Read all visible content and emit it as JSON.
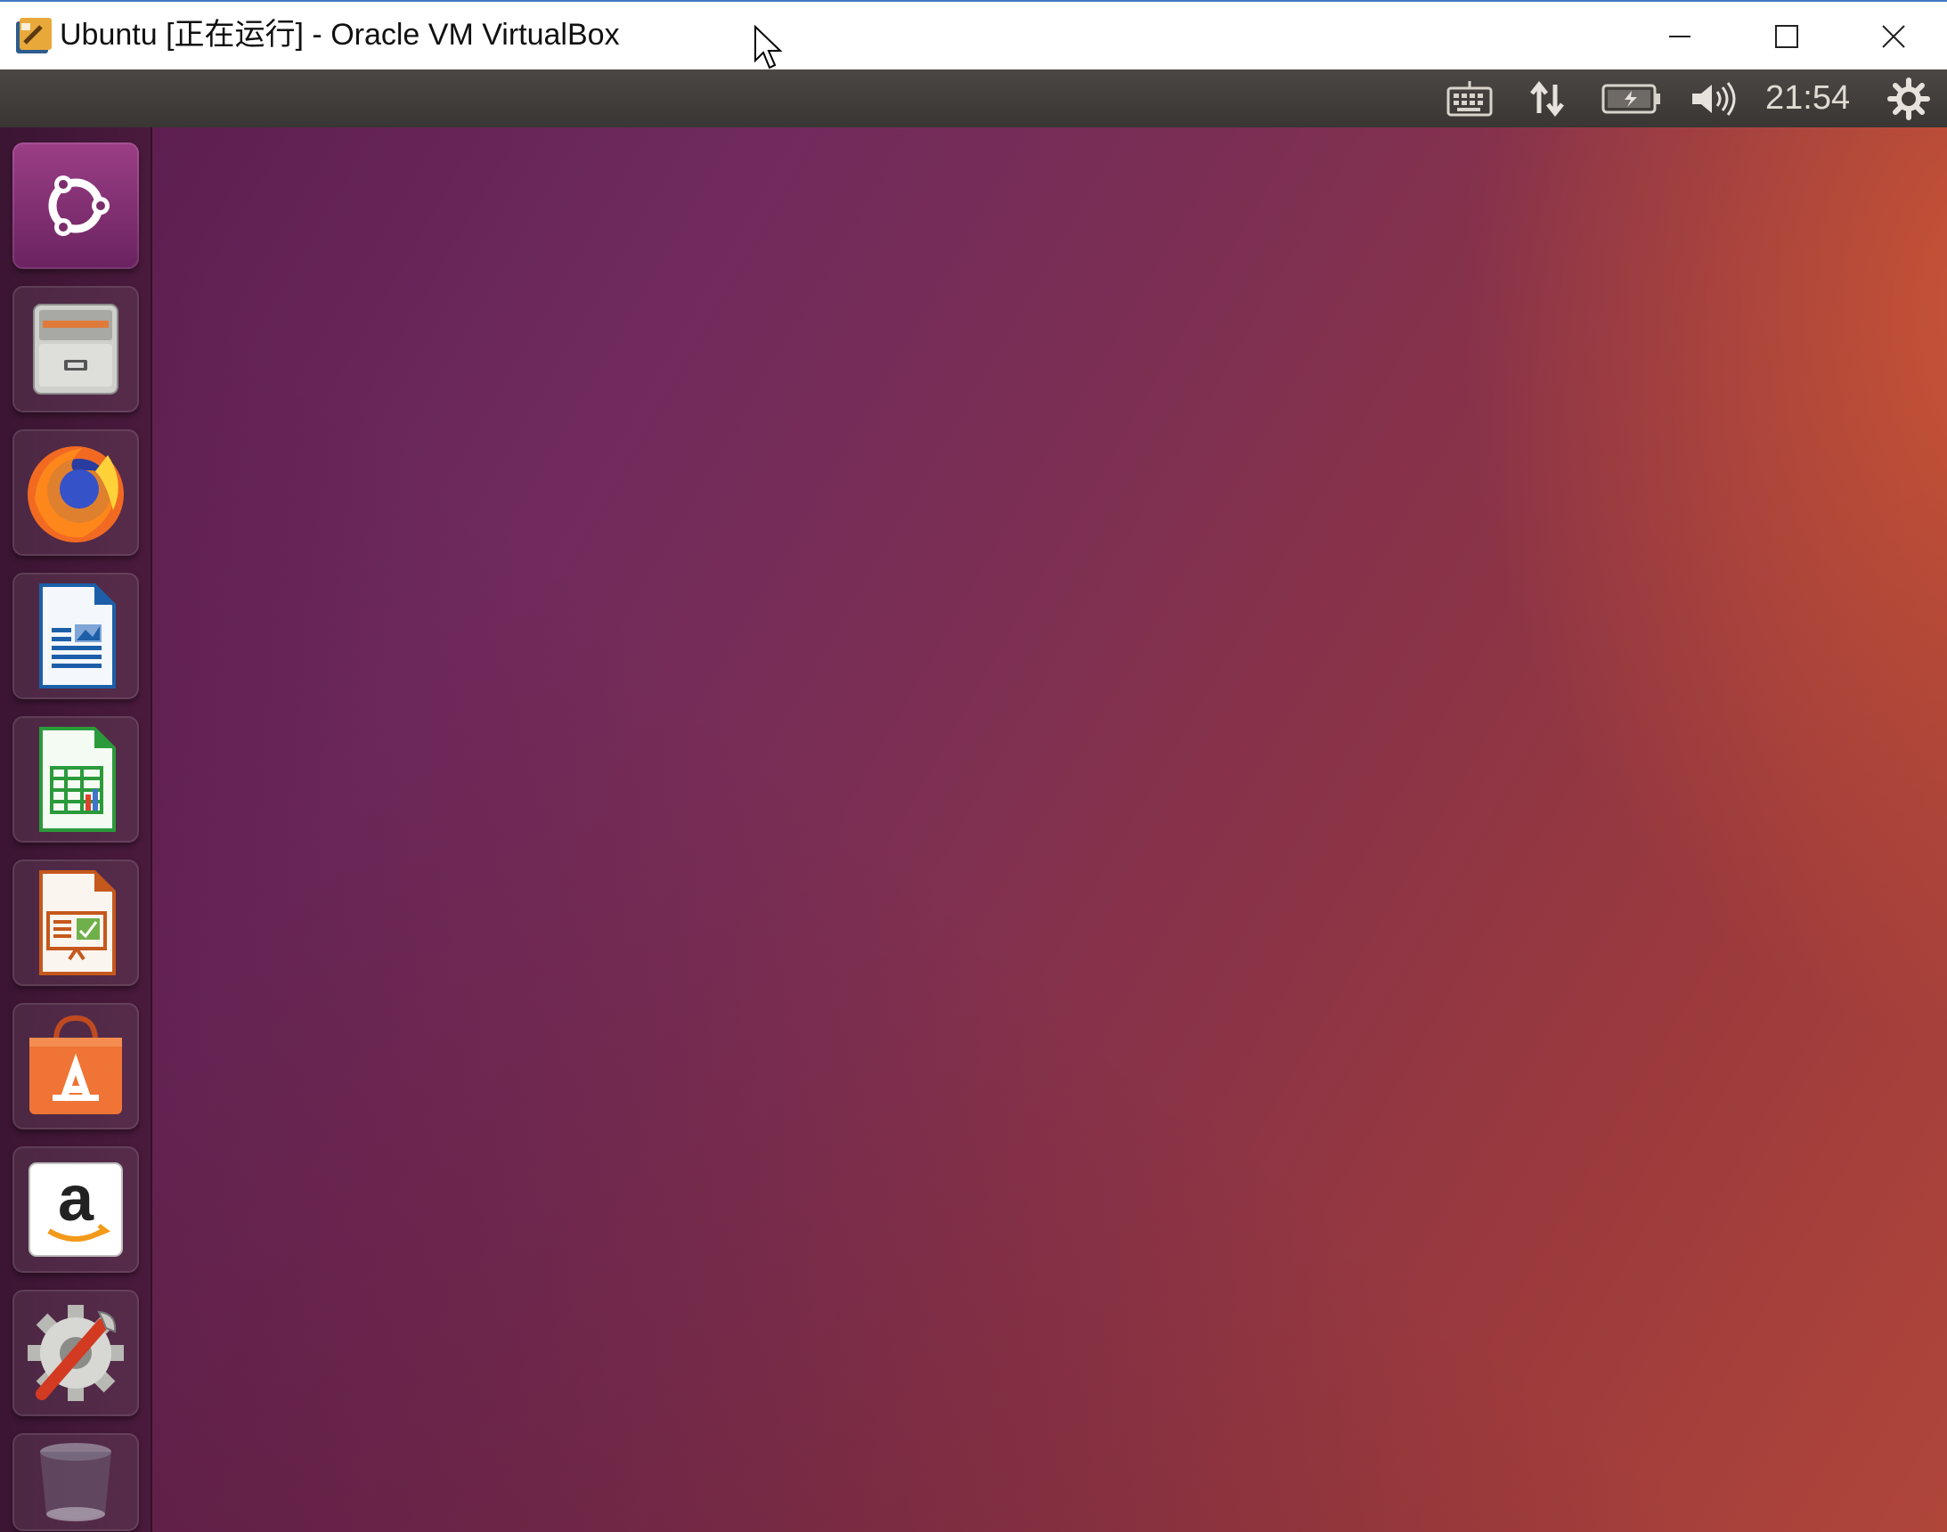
{
  "window": {
    "title": "Ubuntu [正在运行] - Oracle VM VirtualBox",
    "app_icon": "virtualbox-icon",
    "controls": [
      "minimize-icon",
      "maximize-icon",
      "close-icon"
    ]
  },
  "top_panel": {
    "clock": "21:54",
    "indicators": [
      "keyboard-icon",
      "network-icon",
      "battery-icon",
      "volume-icon",
      "settings-gear-icon"
    ]
  },
  "launcher": {
    "items": [
      {
        "name": "Ubuntu Dash",
        "icon": "ubuntu-logo-icon"
      },
      {
        "name": "Files",
        "icon": "file-cabinet-icon"
      },
      {
        "name": "Firefox",
        "icon": "firefox-icon"
      },
      {
        "name": "LibreOffice Writer",
        "icon": "writer-document-icon"
      },
      {
        "name": "LibreOffice Calc",
        "icon": "calc-spreadsheet-icon"
      },
      {
        "name": "LibreOffice Impress",
        "icon": "impress-presentation-icon"
      },
      {
        "name": "Ubuntu Software",
        "icon": "software-bag-icon"
      },
      {
        "name": "Amazon",
        "icon": "amazon-icon"
      },
      {
        "name": "System Settings",
        "icon": "system-settings-icon"
      },
      {
        "name": "Trash",
        "icon": "trash-icon"
      }
    ]
  },
  "colors": {
    "accent_titlebar_border": "#3b78c2",
    "panel": "#3f3c39",
    "launcher": "#431837",
    "desktop_purple": "#6f2a5d",
    "desktop_orange": "#b0463a"
  }
}
